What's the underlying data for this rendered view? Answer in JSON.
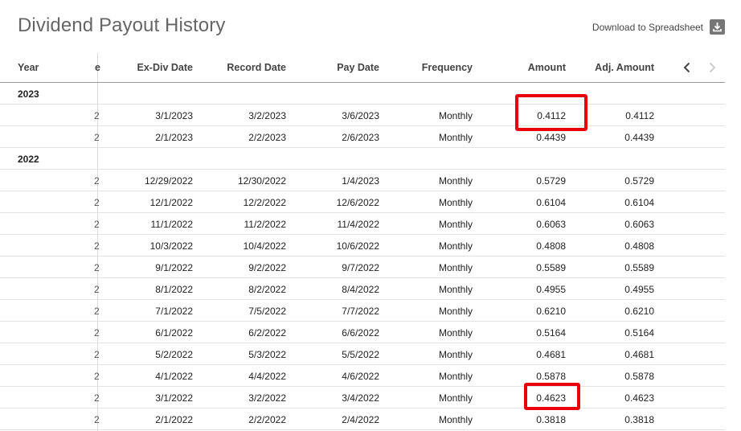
{
  "title": "Dividend Payout History",
  "download_label": "Download to Spreadsheet",
  "columns": {
    "year": "Year",
    "truncated": "e",
    "exdiv": "Ex-Div Date",
    "record": "Record Date",
    "pay": "Pay Date",
    "frequency": "Frequency",
    "amount": "Amount",
    "adj_amount": "Adj. Amount"
  },
  "groups": [
    {
      "year": "2023",
      "rows": [
        {
          "trunc": "2",
          "exdiv": "3/1/2023",
          "record": "3/2/2023",
          "pay": "3/6/2023",
          "freq": "Monthly",
          "amount": "0.4112",
          "adj": "0.4112"
        },
        {
          "trunc": "2",
          "exdiv": "2/1/2023",
          "record": "2/2/2023",
          "pay": "2/6/2023",
          "freq": "Monthly",
          "amount": "0.4439",
          "adj": "0.4439"
        }
      ]
    },
    {
      "year": "2022",
      "rows": [
        {
          "trunc": "2",
          "exdiv": "12/29/2022",
          "record": "12/30/2022",
          "pay": "1/4/2023",
          "freq": "Monthly",
          "amount": "0.5729",
          "adj": "0.5729"
        },
        {
          "trunc": "2",
          "exdiv": "12/1/2022",
          "record": "12/2/2022",
          "pay": "12/6/2022",
          "freq": "Monthly",
          "amount": "0.6104",
          "adj": "0.6104"
        },
        {
          "trunc": "2",
          "exdiv": "11/1/2022",
          "record": "11/2/2022",
          "pay": "11/4/2022",
          "freq": "Monthly",
          "amount": "0.6063",
          "adj": "0.6063"
        },
        {
          "trunc": "2",
          "exdiv": "10/3/2022",
          "record": "10/4/2022",
          "pay": "10/6/2022",
          "freq": "Monthly",
          "amount": "0.4808",
          "adj": "0.4808"
        },
        {
          "trunc": "2",
          "exdiv": "9/1/2022",
          "record": "9/2/2022",
          "pay": "9/7/2022",
          "freq": "Monthly",
          "amount": "0.5589",
          "adj": "0.5589"
        },
        {
          "trunc": "2",
          "exdiv": "8/1/2022",
          "record": "8/2/2022",
          "pay": "8/4/2022",
          "freq": "Monthly",
          "amount": "0.4955",
          "adj": "0.4955"
        },
        {
          "trunc": "2",
          "exdiv": "7/1/2022",
          "record": "7/5/2022",
          "pay": "7/7/2022",
          "freq": "Monthly",
          "amount": "0.6210",
          "adj": "0.6210"
        },
        {
          "trunc": "2",
          "exdiv": "6/1/2022",
          "record": "6/2/2022",
          "pay": "6/6/2022",
          "freq": "Monthly",
          "amount": "0.5164",
          "adj": "0.5164"
        },
        {
          "trunc": "2",
          "exdiv": "5/2/2022",
          "record": "5/3/2022",
          "pay": "5/5/2022",
          "freq": "Monthly",
          "amount": "0.4681",
          "adj": "0.4681"
        },
        {
          "trunc": "2",
          "exdiv": "4/1/2022",
          "record": "4/4/2022",
          "pay": "4/6/2022",
          "freq": "Monthly",
          "amount": "0.5878",
          "adj": "0.5878"
        },
        {
          "trunc": "2",
          "exdiv": "3/1/2022",
          "record": "3/2/2022",
          "pay": "3/4/2022",
          "freq": "Monthly",
          "amount": "0.4623",
          "adj": "0.4623"
        },
        {
          "trunc": "2",
          "exdiv": "2/1/2022",
          "record": "2/2/2022",
          "pay": "2/4/2022",
          "freq": "Monthly",
          "amount": "0.3818",
          "adj": "0.3818"
        }
      ]
    }
  ],
  "highlight_color": "#e8000b",
  "icons": {
    "download": "download-icon",
    "prev": "chevron-left-icon",
    "next": "chevron-right-icon"
  }
}
